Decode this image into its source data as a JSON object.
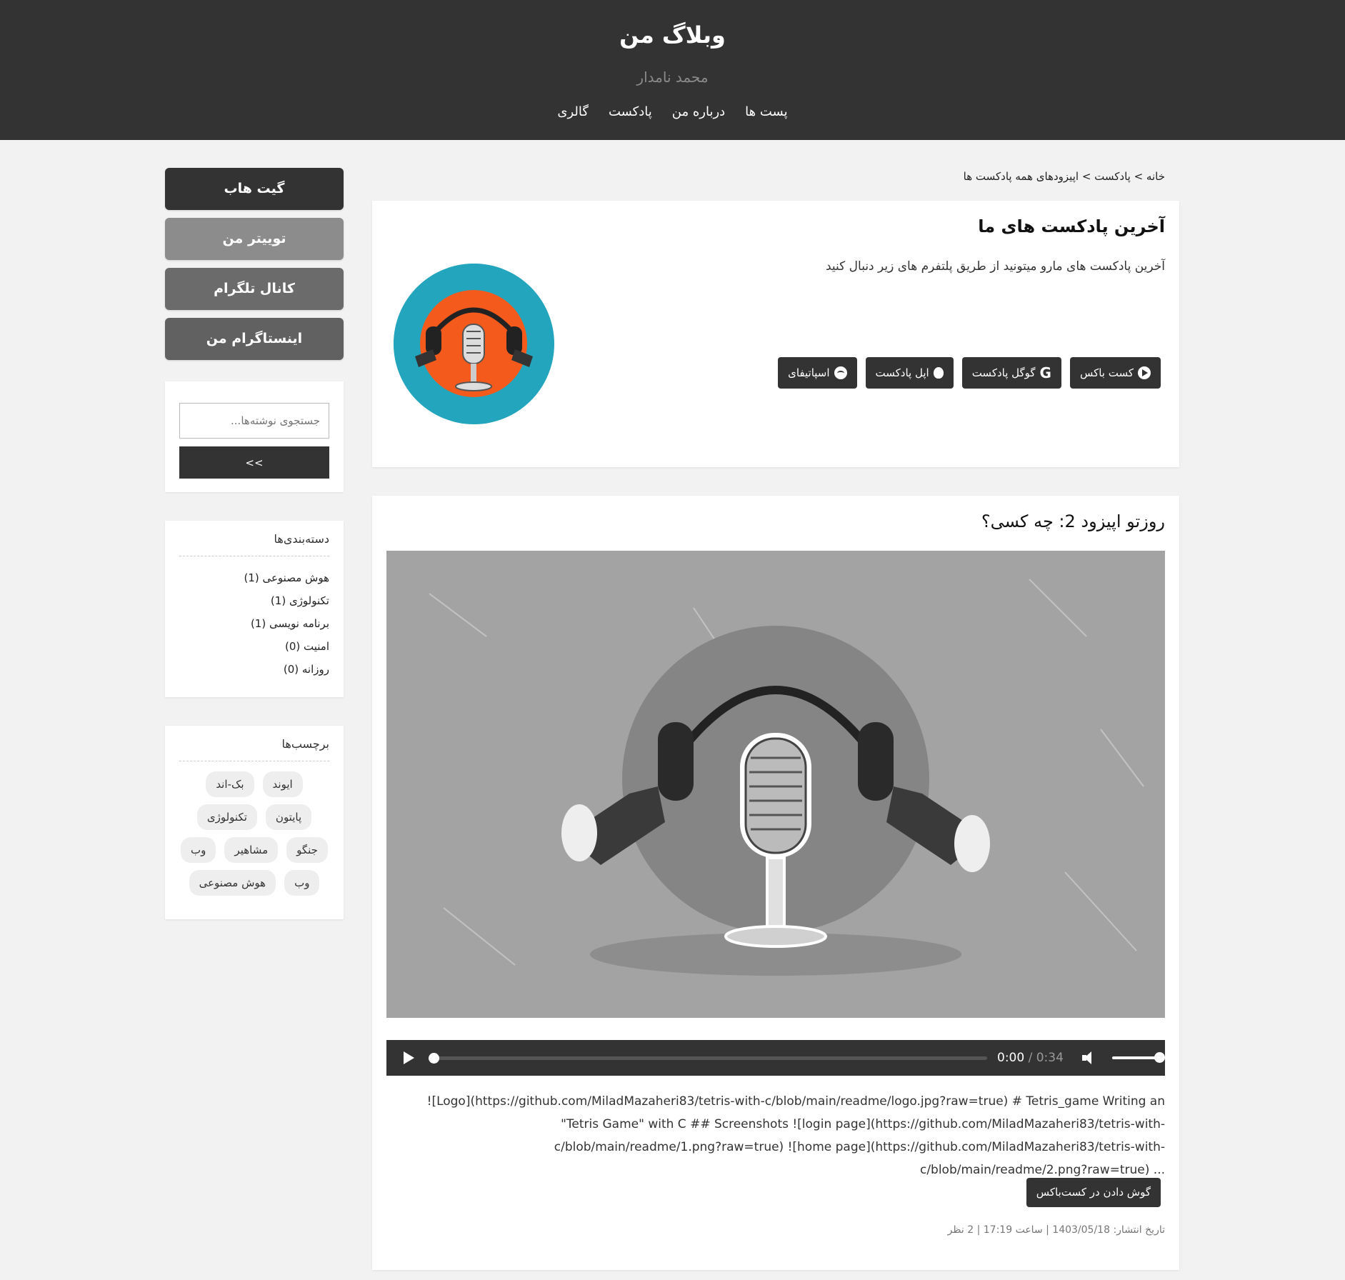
{
  "header": {
    "title": "وبلاگ من",
    "subtitle": "محمد نامدار",
    "nav": [
      "پست ها",
      "درباره من",
      "پادکست",
      "گالری"
    ]
  },
  "sidebar": {
    "social": [
      {
        "label": "گیت هاب",
        "color": "#333333"
      },
      {
        "label": "توییتر من",
        "color": "#8c8c8c"
      },
      {
        "label": "کانال تلگرام",
        "color": "#6b6b6b"
      },
      {
        "label": "اینستاگرام من",
        "color": "#616161"
      }
    ],
    "search": {
      "placeholder": "جستجوی نوشته‌ها...",
      "button": ">>"
    },
    "categories": {
      "title": "دسته‌بندی‌ها",
      "items": [
        "هوش مصنوعی (1)",
        "تکنولوژی (1)",
        "برنامه نویسی (1)",
        "امنیت (0)",
        "روزانه (0)"
      ]
    },
    "tags": {
      "title": "برچسب‌ها",
      "items": [
        "ایوند",
        "بک-اند",
        "پایتون",
        "تکنولوژی",
        "جنگو",
        "مشاهیر",
        "وب",
        "وب",
        "هوش مصنوعی"
      ]
    }
  },
  "breadcrumb": "خانه > پادکست > اپیزودهای همه پادکست ها",
  "podcast": {
    "title": "آخرین پادکست های ما",
    "description": "آخرین پادکست های مارو میتونید از طریق پلتفرم های زیر دنبال کنید",
    "buttons": [
      {
        "label": "کست باکس",
        "icon": "play-circle-icon"
      },
      {
        "label": "گوگل پادکست",
        "icon": "google-icon"
      },
      {
        "label": "اپل پادکست",
        "icon": "apple-icon"
      },
      {
        "label": "اسپاتیفای",
        "icon": "spotify-icon"
      }
    ]
  },
  "episode": {
    "title": "روزتو اپیزود 2: چه کسی؟",
    "player": {
      "current": "0:00",
      "separator": " / ",
      "total": "0:34"
    },
    "text": "![Logo](https://github.com/MiladMazaheri83/tetris-with-c/blob/main/readme/logo.jpg?raw=true) # Tetris_game Writing an \"Tetris Game\" with C ## Screenshots ![login page](https://github.com/MiladMazaheri83/tetris-with-c/blob/main/readme/1.png?raw=true) ![home page](https://github.com/MiladMazaheri83/tetris-with-c/blob/main/readme/2.png?raw=true) ...",
    "listen_button": "گوش دادن در کست‌باکس",
    "meta": "تاریخ انتشار: 1403/05/18 | ساعت 17:19 | 2 نظر"
  }
}
